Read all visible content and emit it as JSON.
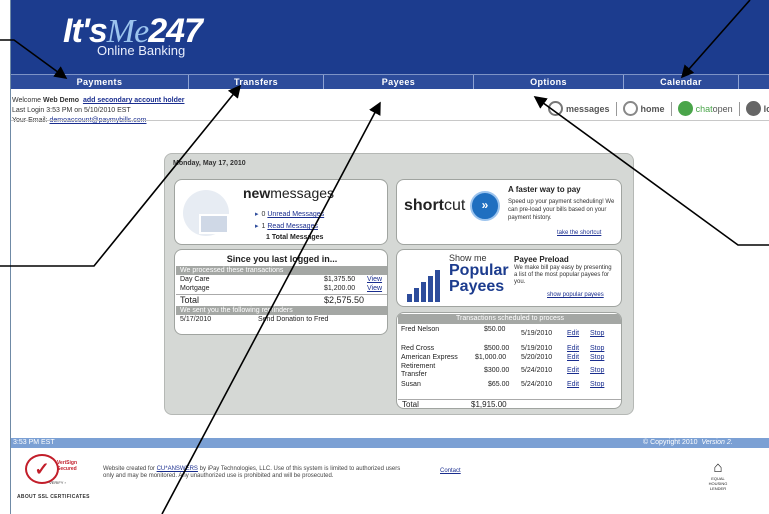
{
  "logo": {
    "its": "It's",
    "me": "Me",
    "num": "247",
    "sub": "Online Banking"
  },
  "nav": [
    {
      "label": "Payments"
    },
    {
      "label": "Transfers"
    },
    {
      "label": "Payees"
    },
    {
      "label": "Options"
    },
    {
      "label": "Calendar"
    }
  ],
  "welcome": {
    "prefix": "Welcome ",
    "name": "Web Demo",
    "add_link": "add secondary account holder",
    "last_login": "Last Login 3:53 PM on 5/10/2010 EST",
    "email_label": "Your Email: ",
    "email": "demoaccount@paymybills.com"
  },
  "toplinks": {
    "messages": "messages",
    "home": "home",
    "chat": "chat",
    "chat_status": "open",
    "logout": "logout"
  },
  "date": "Monday, May 17, 2010",
  "messages": {
    "title_bold": "new",
    "title_rest": "messages",
    "unread_count": "0",
    "unread_label": "Unread Messages",
    "read_count": "1",
    "read_label": "Read Messages",
    "total_label": "1 Total Messages"
  },
  "shortcut": {
    "logo_a": "short",
    "logo_b": "cut",
    "title": "A faster way to pay",
    "desc": "Speed up your payment scheduling! We can pre-load your bills based on your payment history.",
    "link": "take the shortcut"
  },
  "since": {
    "title": "Since you last logged in...",
    "processed_band": "We processed these transactions",
    "processed": [
      {
        "name": "Day Care",
        "amount": "$1,375.50",
        "action": "View"
      },
      {
        "name": "Mortgage",
        "amount": "$1,200.00",
        "action": "View"
      }
    ],
    "total_label": "Total",
    "total_amount": "$2,575.50",
    "reminders_band": "We sent you the following reminders",
    "reminders": [
      {
        "date": "5/17/2010",
        "text": "Send Donation to Fred"
      }
    ]
  },
  "popular": {
    "show_me": "Show me",
    "big1": "Popular",
    "big2": "Payees",
    "title": "Payee Preload",
    "desc": "We make bill pay easy by presenting a list of the most popular payees for you.",
    "link": "show popular payees"
  },
  "scheduled": {
    "title": "Transactions scheduled to process",
    "rows": [
      {
        "name": "Fred Nelson",
        "amount": "$50.00",
        "date": "5/19/2010",
        "edit": "Edit",
        "stop": "Stop"
      },
      {
        "name": "Red Cross",
        "amount": "$500.00",
        "date": "5/19/2010",
        "edit": "Edit",
        "stop": "Stop"
      },
      {
        "name": "American Express",
        "amount": "$1,000.00",
        "date": "5/20/2010",
        "edit": "Edit",
        "stop": "Stop"
      },
      {
        "name": "Retirement Transfer",
        "amount": "$300.00",
        "date": "5/24/2010",
        "edit": "Edit",
        "stop": "Stop"
      },
      {
        "name": "Susan",
        "amount": "$65.00",
        "date": "5/24/2010",
        "edit": "Edit",
        "stop": "Stop"
      }
    ],
    "total_label": "Total",
    "total_amount": "$1,915.00"
  },
  "status": {
    "time": "3:53 PM EST",
    "copyright": "© Copyright 2010",
    "version": "Version 2."
  },
  "footer": {
    "seal_a": "VeriSign",
    "seal_b": "Secured",
    "verify": "VERIFY ›",
    "about": "ABOUT SSL CERTIFICATES",
    "text_pre": "Website created for ",
    "text_link": "CU*ANSWERS",
    "text_post": " by iPay Technologies, LLC. Use of this system is limited to authorized users only and may be monitored. Any unauthorized use is prohibited and will be prosecuted.",
    "contact": "Contact",
    "eho": "EQUAL HOUSING LENDER"
  },
  "colors": {
    "header": "#1c3c8e",
    "nav": "#2d4c9b",
    "status": "#7ba0d4",
    "link": "#1a2e8f"
  }
}
